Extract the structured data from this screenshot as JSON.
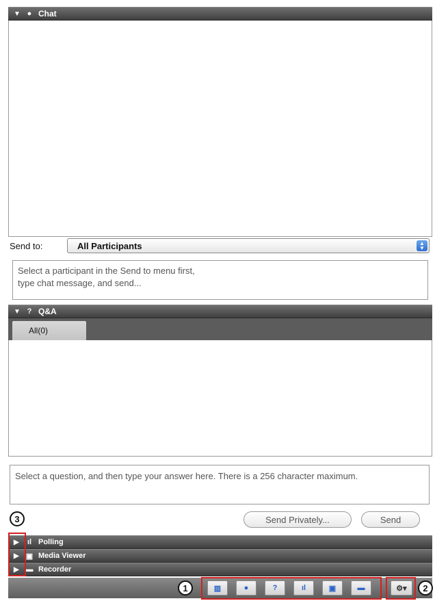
{
  "chat": {
    "header": "Chat",
    "sendto_label": "Send to:",
    "sendto_value": "All Participants",
    "input_placeholder": "Select a participant in the Send to menu first,\ntype chat message, and send..."
  },
  "qa": {
    "header": "Q&A",
    "tab_label": "All(0)",
    "input_placeholder": "Select a question, and then type your answer here. There is a 256 character maximum.",
    "send_privately_label": "Send Privately...",
    "send_label": "Send"
  },
  "collapsed_panels": [
    {
      "label": "Polling",
      "icon": "polling-icon"
    },
    {
      "label": "Media Viewer",
      "icon": "media-viewer-icon"
    },
    {
      "label": "Recorder",
      "icon": "recorder-icon"
    }
  ],
  "callouts": [
    "1",
    "2",
    "3"
  ],
  "toolbar": {
    "buttons": [
      "participants-icon",
      "chat-icon",
      "qa-icon",
      "polling-icon",
      "media-viewer-icon",
      "recorder-icon"
    ],
    "options_icon": "gear-icon"
  },
  "colors": {
    "header_bg": "#4a4a4a",
    "callout_border": "#d42020",
    "select_arrow": "#2d6fd0"
  }
}
